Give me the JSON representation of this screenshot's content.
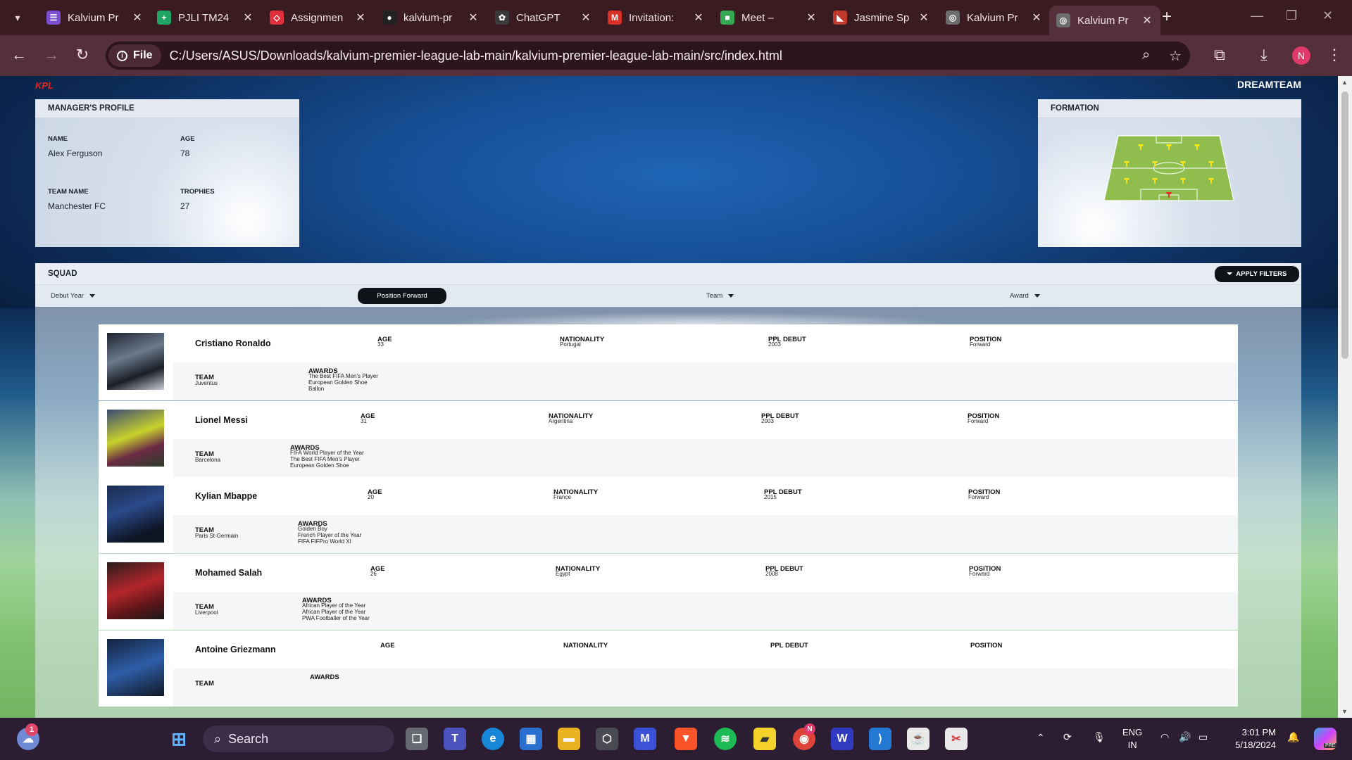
{
  "browser": {
    "tabs": [
      {
        "title": "Kalvium Pr",
        "favicon": "kalvium-icon",
        "color": "#7b4fd0",
        "glyph": "☰"
      },
      {
        "title": "PJLI TM24",
        "favicon": "sheets-icon",
        "color": "#1fa463",
        "glyph": "+"
      },
      {
        "title": "Assignmen",
        "favicon": "assignment-icon",
        "color": "#e0303c",
        "glyph": "◇"
      },
      {
        "title": "kalvium-pr",
        "favicon": "github-icon",
        "color": "#222222",
        "glyph": "●"
      },
      {
        "title": "ChatGPT",
        "favicon": "chatgpt-icon",
        "color": "#3a3a3a",
        "glyph": "✿"
      },
      {
        "title": "Invitation:",
        "favicon": "gmail-icon",
        "color": "#d93025",
        "glyph": "M"
      },
      {
        "title": "Meet –",
        "favicon": "meet-icon",
        "color": "#34a853",
        "glyph": "■"
      },
      {
        "title": "Jasmine Sp",
        "favicon": "jasmine-icon",
        "color": "#c0392b",
        "glyph": "◣"
      },
      {
        "title": "Kalvium Pr",
        "favicon": "globe-icon",
        "color": "#6d6d6d",
        "glyph": "◎"
      },
      {
        "title": "Kalvium Pr",
        "favicon": "globe-icon",
        "color": "#6d6d6d",
        "glyph": "◎"
      }
    ],
    "chip": "File",
    "url": "C:/Users/ASUS/Downloads/kalvium-premier-league-lab-main/kalvium-premier-league-lab-main/src/index.html",
    "profile_initial": "N"
  },
  "page": {
    "logo": "KPL",
    "brand": "DREAMTEAM",
    "manager": {
      "heading": "MANAGER'S PROFILE",
      "name_label": "NAME",
      "name": "Alex Ferguson",
      "age_label": "AGE",
      "age": "78",
      "team_label": "TEAM NAME",
      "team": "Manchester FC",
      "trophies_label": "TROPHIES",
      "trophies": "27"
    },
    "formation": {
      "heading": "FORMATION"
    },
    "squad": {
      "heading": "SQUAD",
      "apply_label": "APPLY FILTERS",
      "filters": {
        "debut": "Debut Year",
        "position": "Position  Forward",
        "team": "Team",
        "award": "Award"
      },
      "labels": {
        "age": "AGE",
        "nationality": "NATIONALITY",
        "debut": "PPL DEBUT",
        "position": "POSITION",
        "team": "TEAM",
        "awards": "AWARDS"
      },
      "players": [
        {
          "name": "Cristiano Ronaldo",
          "age": "33",
          "nationality": "Portugal",
          "debut": "2003",
          "position": "Forward",
          "team": "Juventus",
          "awards": [
            "The Best FIFA Men's Player",
            "European Golden Shoe",
            "Ballon"
          ]
        },
        {
          "name": "Lionel Messi",
          "age": "31",
          "nationality": "Argentina",
          "debut": "2003",
          "position": "Forward",
          "team": "Barcelona",
          "awards": [
            "FIFA World Player of the Year",
            "The Best FIFA Men's Player",
            "European Golden Shoe"
          ]
        },
        {
          "name": "Kylian Mbappe",
          "age": "20",
          "nationality": "France",
          "debut": "2015",
          "position": "Forward",
          "team": "Paris St-Germain",
          "awards": [
            "Golden Boy",
            "French Player of the Year",
            "FIFA FIFPro World XI"
          ]
        },
        {
          "name": "Mohamed Salah",
          "age": "26",
          "nationality": "Egypt",
          "debut": "2008",
          "position": "Forward",
          "team": "Liverpool",
          "awards": [
            "African Player of the Year",
            "African Player of the Year",
            "PWA Footballer of the Year"
          ]
        },
        {
          "name": "Antoine Griezmann",
          "age": "",
          "nationality": "",
          "debut": "",
          "position": "",
          "team": "",
          "awards": []
        }
      ]
    }
  },
  "taskbar": {
    "search_label": "Search",
    "notification_count": "1",
    "lang": "ENG",
    "region": "IN",
    "time": "3:01 PM",
    "date": "5/18/2024",
    "chrome_badge": "N",
    "copilot_badge": "PRE"
  }
}
